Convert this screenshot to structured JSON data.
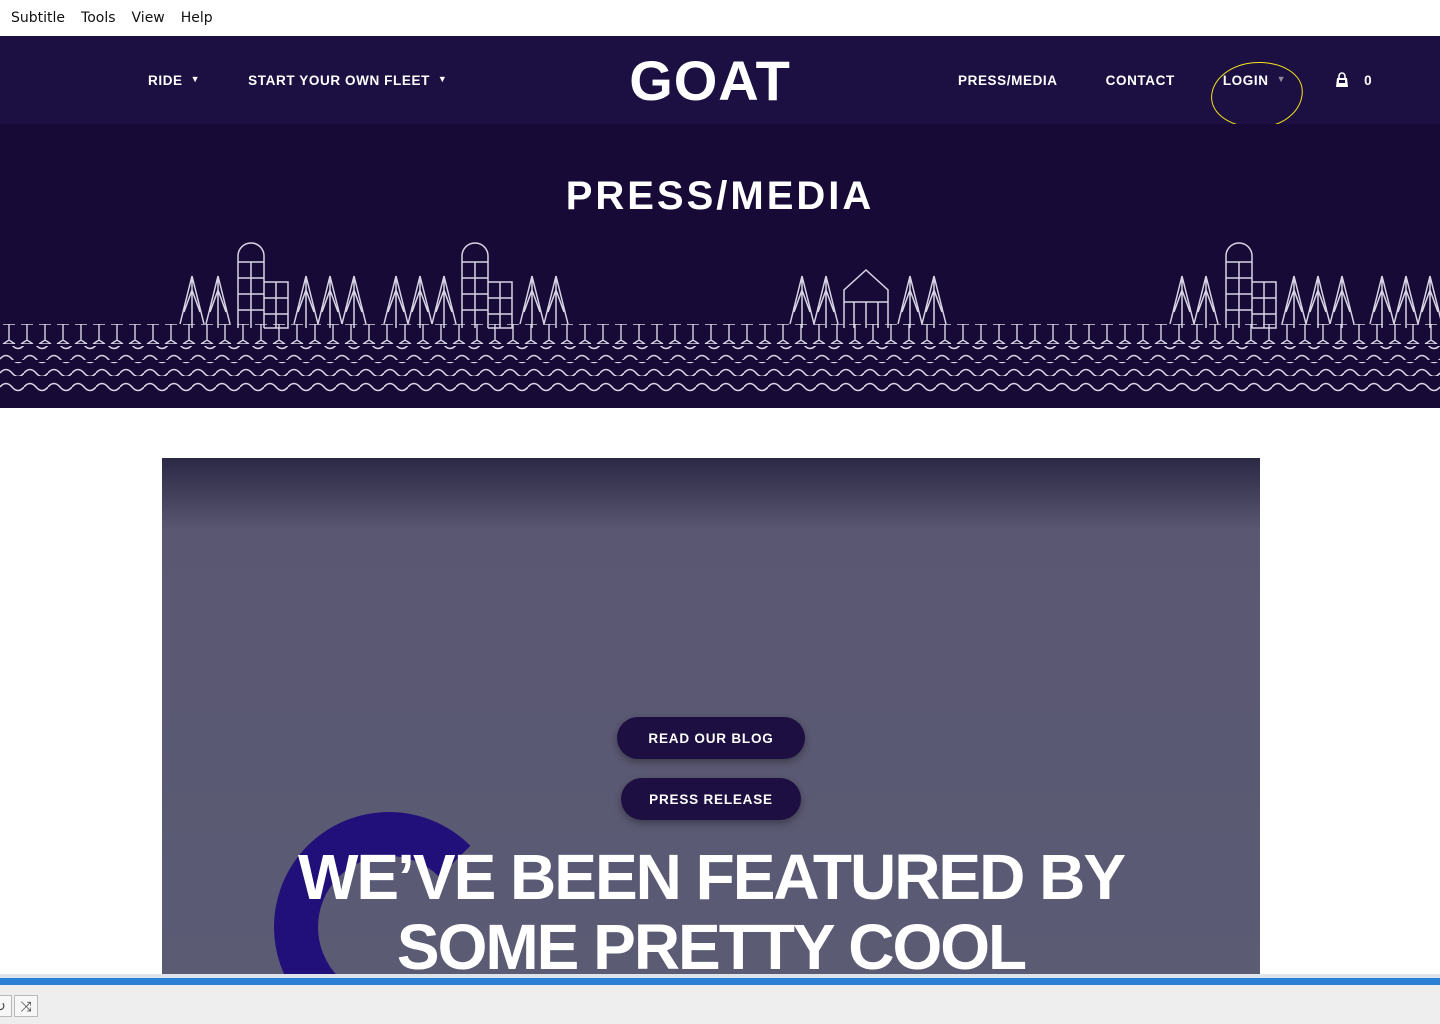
{
  "app_menu": [
    "Subtitle",
    "Tools",
    "View",
    "Help"
  ],
  "nav": {
    "left": [
      {
        "label": "RIDE",
        "dropdown": true
      },
      {
        "label": "START YOUR OWN FLEET",
        "dropdown": true
      }
    ],
    "logo": "GOAT",
    "right": [
      {
        "label": "PRESS/MEDIA"
      },
      {
        "label": "CONTACT"
      },
      {
        "label": "LOGIN"
      }
    ],
    "cart_count": "0"
  },
  "hero": {
    "title": "PRESS/MEDIA"
  },
  "content": {
    "buttons": {
      "blog": "READ OUR BLOG",
      "press": "PRESS RELEASE"
    },
    "headline_line1": "WE’VE BEEN FEATURED BY",
    "headline_line2": "SOME PRETTY COOL"
  },
  "colors": {
    "header_bg": "#1c1043",
    "hero_bg": "#170a36",
    "button_bg": "#1e0f42",
    "annotation": "#f5e51a",
    "progress": "#2b7fd4"
  }
}
